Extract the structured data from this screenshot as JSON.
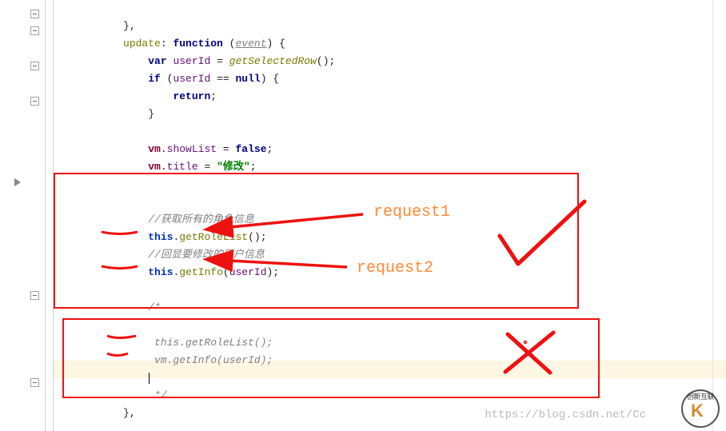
{
  "code": {
    "l0": "    },",
    "l1_kw1": "update",
    "l1_seg1": ": ",
    "l1_kw2": "function",
    "l1_seg2": " (",
    "l1_ev": "event",
    "l1_seg3": ") {",
    "l2_kw": "var",
    "l2_seg1": " ",
    "l2_id": "userId",
    "l2_seg2": " = ",
    "l2_fn": "getSelectedRow",
    "l2_seg3": "();",
    "l3_kw": "if",
    "l3_seg1": " (",
    "l3_id": "userId",
    "l3_seg2": " == ",
    "l3_kw2": "null",
    "l3_seg3": ") {",
    "l4_kw": "return",
    "l4_end": ";",
    "l5": "        }",
    "l6_ref": "vm",
    "l6_seg1": ".",
    "l6_id": "showList",
    "l6_seg2": " = ",
    "l6_kw": "false",
    "l6_end": ";",
    "l7_ref": "vm",
    "l7_seg1": ".",
    "l7_id": "title",
    "l7_seg2": " = ",
    "l7_str": "\"修改\"",
    "l7_end": ";",
    "cmt1": "//获取所有的角色信息",
    "l8_kw": "this",
    "l8_seg1": ".",
    "l8_fn": "getRoleList",
    "l8_seg2": "();",
    "cmt2": "//回显要修改的用户信息",
    "l9_kw": "this",
    "l9_seg1": ".",
    "l9_fn": "getInfo",
    "l9_seg2": "(",
    "l9_id": "userId",
    "l9_seg3": ");",
    "blkopen": "/*",
    "l10_cmt": "  this.getRoleList();",
    "l11_cmt": "  vm.getInfo(userId);",
    "blkclose": " */",
    "lend": "    },"
  },
  "annotations": {
    "req1": "request1",
    "req2": "request2"
  },
  "watermark": {
    "url": "https://blog.csdn.net/Cc",
    "logo_text": "创新互联"
  }
}
